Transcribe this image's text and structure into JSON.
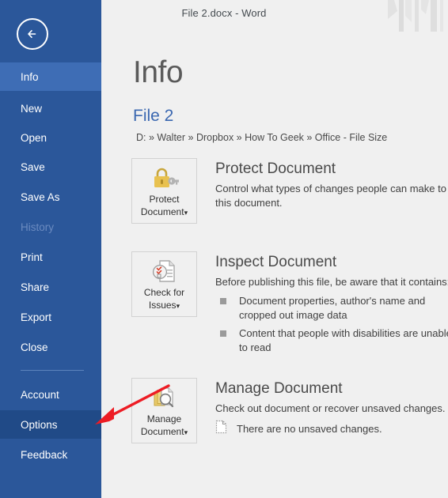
{
  "window": {
    "title": "File 2.docx - Word"
  },
  "sidebar": {
    "back_icon": "back-arrow-icon",
    "items": [
      {
        "label": "Info",
        "state": "selected"
      },
      {
        "label": "New",
        "state": "normal"
      },
      {
        "label": "Open",
        "state": "normal"
      },
      {
        "label": "Save",
        "state": "normal"
      },
      {
        "label": "Save As",
        "state": "normal"
      },
      {
        "label": "History",
        "state": "disabled"
      },
      {
        "label": "Print",
        "state": "normal"
      },
      {
        "label": "Share",
        "state": "normal"
      },
      {
        "label": "Export",
        "state": "normal"
      },
      {
        "label": "Close",
        "state": "normal"
      },
      {
        "label": "Account",
        "state": "normal"
      },
      {
        "label": "Options",
        "state": "hovered"
      },
      {
        "label": "Feedback",
        "state": "normal"
      }
    ]
  },
  "main": {
    "heading": "Info",
    "file_name": "File 2",
    "file_path": "D: » Walter » Dropbox » How To Geek » Office - File Size",
    "sections": [
      {
        "id": "protect-document",
        "button_label_line1": "Protect",
        "button_label_line2": "Document",
        "button_caret": "▾",
        "button_icon": "padlock-key-icon",
        "title": "Protect Document",
        "description": "Control what types of changes people can make to this document."
      },
      {
        "id": "inspect-document",
        "button_label_line1": "Check for",
        "button_label_line2": "Issues",
        "button_caret": "▾",
        "button_icon": "document-check-icon",
        "title": "Inspect Document",
        "description": "Before publishing this file, be aware that it contains:",
        "bullets": [
          "Document properties, author's name and cropped out image data",
          "Content that people with disabilities are unable to read"
        ]
      },
      {
        "id": "manage-document",
        "button_label_line1": "Manage",
        "button_label_line2": "Document",
        "button_caret": "▾",
        "button_icon": "document-stack-magnifier-icon",
        "title": "Manage Document",
        "description": "Check out document or recover unsaved changes.",
        "note_icon": "unsaved-document-icon",
        "note": "There are no unsaved changes."
      }
    ]
  },
  "annotation": {
    "type": "red-arrow",
    "color": "#ed1c24",
    "points_to": "Options"
  },
  "colors": {
    "sidebar_base": "#2b579a",
    "sidebar_selected": "#3e6db5",
    "sidebar_hovered": "#204a87",
    "sidebar_disabled_text": "#6b8bc0",
    "content_bg": "#f0f0f0",
    "file_title": "#3a67b0",
    "heading": "#5a5a5a",
    "annotation_red": "#ed1c24"
  }
}
